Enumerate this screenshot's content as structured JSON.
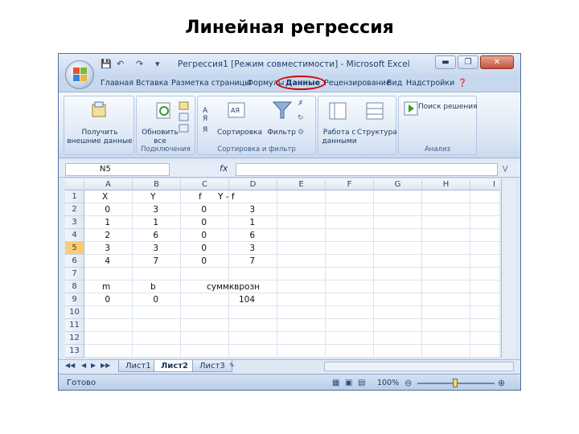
{
  "slide": {
    "title": "Линейная регрессия"
  },
  "window": {
    "title": "Регрессия1 [Режим совместимости] - Microsoft Excel",
    "minimize": "▬",
    "maximize": "❐",
    "close": "✕"
  },
  "tabs": [
    "Главная",
    "Вставка",
    "Разметка страницы",
    "Формулы",
    "Данные",
    "Рецензирование",
    "Вид",
    "Надстройки"
  ],
  "active_tab": "Данные",
  "ribbon": {
    "get_external": "Получить\nвнешние данные",
    "refresh_all": "Обновить\nвсе",
    "group_connections": "Подключения",
    "sort": "Сортировка",
    "filter": "Фильтр",
    "group_sort_filter": "Сортировка и фильтр",
    "data_tools": "Работа с\nданными",
    "outline": "Структура",
    "solver": "Поиск решения",
    "group_analysis": "Анализ"
  },
  "formula_bar": {
    "name_box": "N5",
    "fx": "fx",
    "content": ""
  },
  "columns": [
    "A",
    "B",
    "C",
    "D",
    "E",
    "F",
    "G",
    "H",
    "I"
  ],
  "rows": [
    "1",
    "2",
    "3",
    "4",
    "5",
    "6",
    "7",
    "8",
    "9",
    "10",
    "11",
    "12",
    "13"
  ],
  "active_row": "5",
  "cells": {
    "A1": "X",
    "B1": "Y",
    "C1": "f",
    "D1": "Y - f",
    "A2": "0",
    "B2": "3",
    "C2": "0",
    "D2": "3",
    "A3": "1",
    "B3": "1",
    "C3": "0",
    "D3": "1",
    "A4": "2",
    "B4": "6",
    "C4": "0",
    "D4": "6",
    "A5": "3",
    "B5": "3",
    "C5": "0",
    "D5": "3",
    "A6": "4",
    "B6": "7",
    "C6": "0",
    "D6": "7",
    "A8": "m",
    "B8": "b",
    "D8": "суммкврозн",
    "A9": "0",
    "B9": "0",
    "D9": "104"
  },
  "sheets": [
    "Лист1",
    "Лист2",
    "Лист3"
  ],
  "active_sheet": "Лист2",
  "status": {
    "text": "Готово",
    "zoom": "100%"
  }
}
